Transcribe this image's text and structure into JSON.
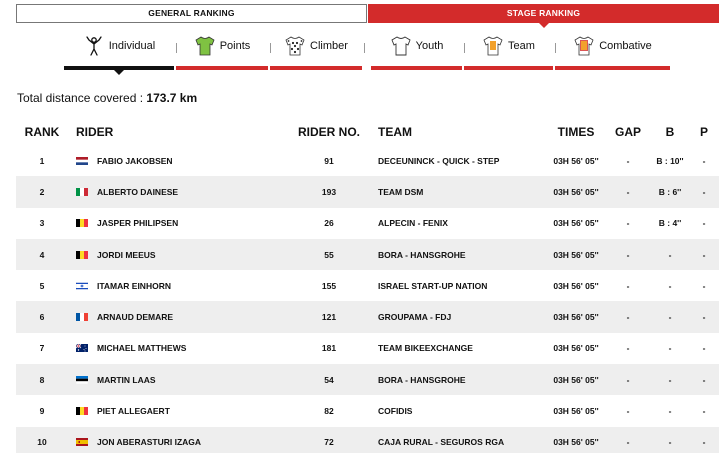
{
  "ranking_tabs": [
    {
      "label": "GENERAL RANKING",
      "active": false
    },
    {
      "label": "STAGE RANKING",
      "active": true
    }
  ],
  "sub_tabs": [
    {
      "label": "Individual",
      "icon": "cyclist-icon",
      "active": true
    },
    {
      "label": "Points",
      "icon": "green-jersey-icon",
      "active": false
    },
    {
      "label": "Climber",
      "icon": "polka-dot-jersey-icon",
      "active": false
    },
    {
      "label": "Youth",
      "icon": "white-jersey-icon",
      "active": false
    },
    {
      "label": "Team",
      "icon": "team-jersey-icon",
      "active": false
    },
    {
      "label": "Combative",
      "icon": "combative-jersey-icon",
      "active": false
    }
  ],
  "distance": {
    "label": "Total distance covered :",
    "value": "173.7 km"
  },
  "columns": {
    "rank": "RANK",
    "rider": "RIDER",
    "rider_no": "RIDER NO.",
    "team": "TEAM",
    "times": "TIMES",
    "gap": "GAP",
    "b": "B",
    "p": "P"
  },
  "rows": [
    {
      "rank": "1",
      "flag": "nl",
      "rider": "FABIO JAKOBSEN",
      "no": "91",
      "team": "DECEUNINCK - QUICK - STEP",
      "time": "03H 56' 05''",
      "gap": "-",
      "b": "B : 10''",
      "p": "-"
    },
    {
      "rank": "2",
      "flag": "it",
      "rider": "ALBERTO DAINESE",
      "no": "193",
      "team": "TEAM DSM",
      "time": "03H 56' 05''",
      "gap": "-",
      "b": "B : 6''",
      "p": "-"
    },
    {
      "rank": "3",
      "flag": "be",
      "rider": "JASPER PHILIPSEN",
      "no": "26",
      "team": "ALPECIN - FENIX",
      "time": "03H 56' 05''",
      "gap": "-",
      "b": "B : 4''",
      "p": "-"
    },
    {
      "rank": "4",
      "flag": "be",
      "rider": "JORDI MEEUS",
      "no": "55",
      "team": "BORA - HANSGROHE",
      "time": "03H 56' 05''",
      "gap": "-",
      "b": "-",
      "p": "-"
    },
    {
      "rank": "5",
      "flag": "il",
      "rider": "ITAMAR EINHORN",
      "no": "155",
      "team": "ISRAEL START-UP NATION",
      "time": "03H 56' 05''",
      "gap": "-",
      "b": "-",
      "p": "-"
    },
    {
      "rank": "6",
      "flag": "fr",
      "rider": "ARNAUD DEMARE",
      "no": "121",
      "team": "GROUPAMA - FDJ",
      "time": "03H 56' 05''",
      "gap": "-",
      "b": "-",
      "p": "-"
    },
    {
      "rank": "7",
      "flag": "au",
      "rider": "MICHAEL MATTHEWS",
      "no": "181",
      "team": "TEAM BIKEEXCHANGE",
      "time": "03H 56' 05''",
      "gap": "-",
      "b": "-",
      "p": "-"
    },
    {
      "rank": "8",
      "flag": "ee",
      "rider": "MARTIN LAAS",
      "no": "54",
      "team": "BORA - HANSGROHE",
      "time": "03H 56' 05''",
      "gap": "-",
      "b": "-",
      "p": "-"
    },
    {
      "rank": "9",
      "flag": "be",
      "rider": "PIET ALLEGAERT",
      "no": "82",
      "team": "COFIDIS",
      "time": "03H 56' 05''",
      "gap": "-",
      "b": "-",
      "p": "-"
    },
    {
      "rank": "10",
      "flag": "es",
      "rider": "JON ABERASTURI IZAGA",
      "no": "72",
      "team": "CAJA RURAL - SEGUROS RGA",
      "time": "03H 56' 05''",
      "gap": "-",
      "b": "-",
      "p": "-"
    }
  ],
  "colors": {
    "accent": "#d32b2b",
    "active_underline": "#111111",
    "row_alt": "#eeeeee"
  }
}
